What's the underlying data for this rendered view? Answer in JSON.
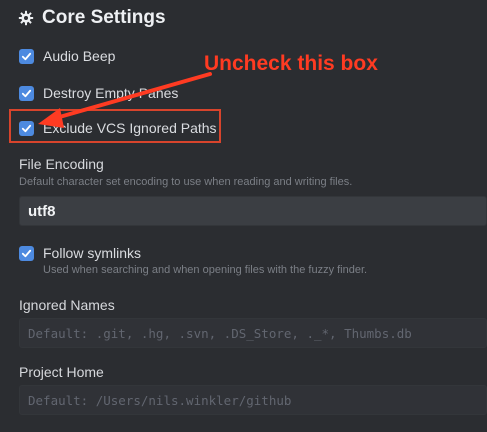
{
  "section": {
    "title": "Core Settings",
    "icon": "gear-icon"
  },
  "checkboxes": {
    "audio_beep": {
      "label": "Audio Beep",
      "checked": true
    },
    "destroy_empty_panes": {
      "label": "Destroy Empty Panes",
      "checked": true
    },
    "exclude_vcs": {
      "label": "Exclude VCS Ignored Paths",
      "checked": true
    },
    "follow_symlinks": {
      "label": "Follow symlinks",
      "checked": true,
      "description": "Used when searching and when opening files with the fuzzy finder."
    }
  },
  "file_encoding": {
    "label": "File Encoding",
    "description": "Default character set encoding to use when reading and writing files.",
    "value": "utf8"
  },
  "ignored_names": {
    "label": "Ignored Names",
    "placeholder": "Default: .git, .hg, .svn, .DS_Store, ._*, Thumbs.db"
  },
  "project_home": {
    "label": "Project Home",
    "placeholder": "Default: /Users/nils.winkler/github"
  },
  "annotation": {
    "text": "Uncheck this box",
    "color": "#ff3b22"
  },
  "colors": {
    "accent": "#4d8ae0",
    "background": "#2b2d31"
  }
}
